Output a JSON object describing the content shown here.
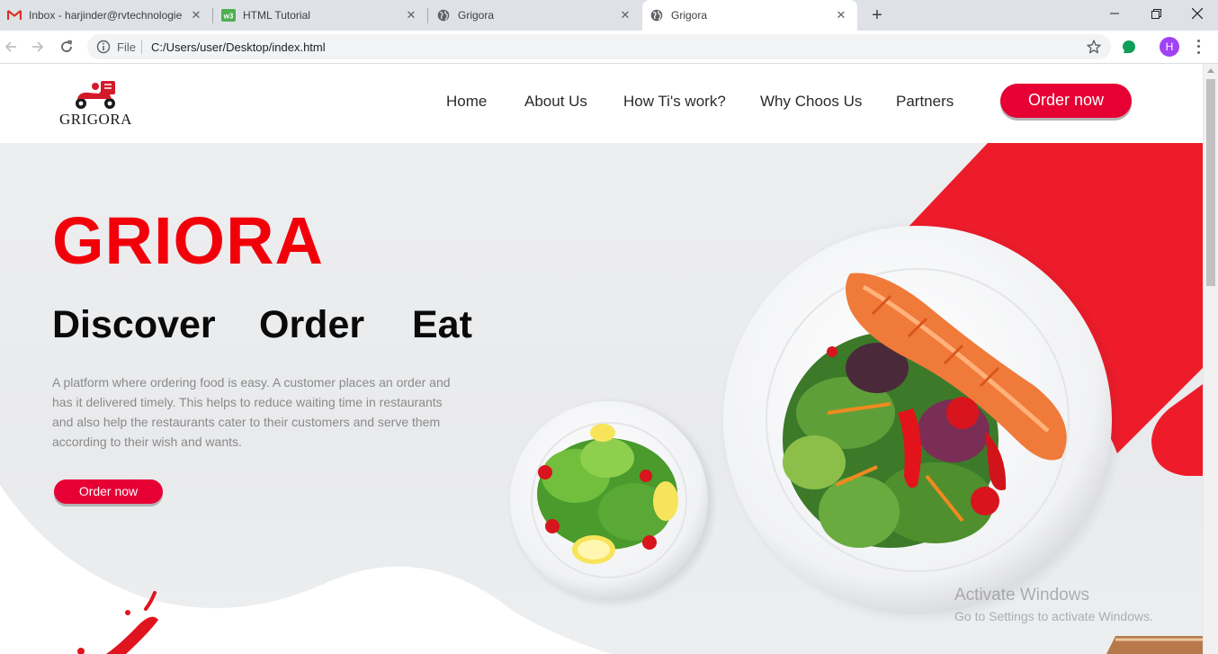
{
  "browser": {
    "tabs": [
      {
        "title": "Inbox - harjinder@rvtechnologie",
        "icon": "gmail-icon"
      },
      {
        "title": "HTML Tutorial",
        "icon": "w3schools-icon"
      },
      {
        "title": "Grigora",
        "icon": "globe-icon"
      },
      {
        "title": "Grigora",
        "icon": "globe-icon"
      }
    ],
    "active_tab": 3,
    "address": {
      "scheme_label": "File",
      "url": "C:/Users/user/Desktop/index.html"
    },
    "profile_initial": "H"
  },
  "site": {
    "logo_text": "GRIGORA",
    "nav": [
      "Home",
      "About Us",
      "How Ti's work?",
      "Why Choos Us",
      "Partners"
    ],
    "order_button": "Order now"
  },
  "hero": {
    "brand": "GRIORA",
    "tagline": [
      "Discover",
      "Order",
      "Eat"
    ],
    "description": "A platform where ordering food is easy. A customer places an order and has it delivered timely. This helps to reduce waiting time in restaurants and also help the restaurants cater to their customers and serve them according to their wish and wants.",
    "order_button": "Order now"
  },
  "os_watermark": {
    "title": "Activate Windows",
    "subtitle": "Go to Settings to activate Windows."
  },
  "colors": {
    "accent": "#e60034",
    "brand_red": "#f2000a",
    "tab_strip": "#dee1e6"
  }
}
